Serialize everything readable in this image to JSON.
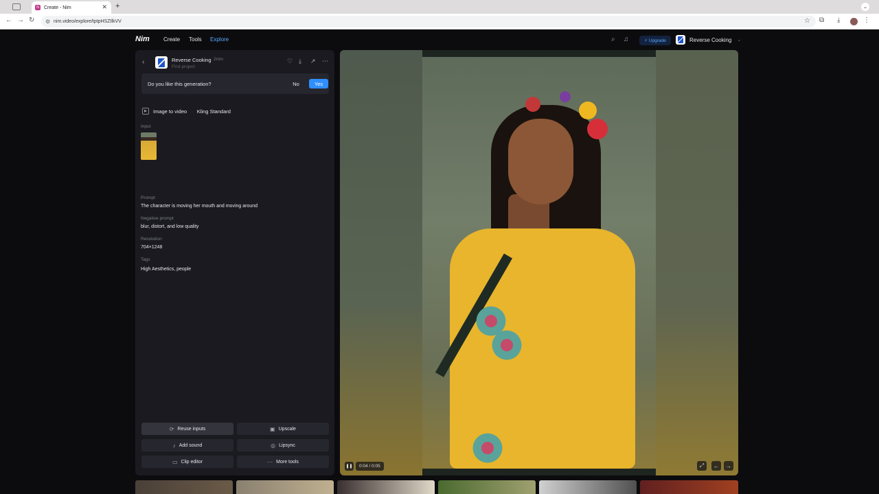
{
  "browser": {
    "tab_title": "Create - Nim",
    "tab_favicon": "N",
    "url": "nim.video/explore/tptpHSZIlkVV"
  },
  "nav": {
    "logo": "Nim",
    "links": [
      "Create",
      "Tools",
      "Explore"
    ],
    "active": "Explore",
    "upgrade_label": "Upgrade",
    "account_name": "Reverse Cooking"
  },
  "generation": {
    "project_title": "Reverse Cooking",
    "time_ago": "2min",
    "project_subtitle": "First project",
    "feedback_question": "Do you like this generation?",
    "feedback_no": "No",
    "feedback_yes": "Yes",
    "mode": "Image to video",
    "model": "Kling Standard",
    "input_label": "Input",
    "prompt_label": "Prompt",
    "prompt": "The character is moving her mouth and moving around",
    "negative_prompt_label": "Negative prompt",
    "negative_prompt": "blur, distort, and low quality",
    "resolution_label": "Resolution",
    "resolution": "704×1248",
    "tags_label": "Tags",
    "tags": "High Aesthetics, people"
  },
  "actions": {
    "reuse_inputs": "Reuse inputs",
    "upscale": "Upscale",
    "add_sound": "Add sound",
    "lipsync": "Lipsync",
    "clip_editor": "Clip editor",
    "more_tools": "More tools"
  },
  "player": {
    "time": "0:04 / 0:05"
  },
  "colors": {
    "accent": "#2f8fff",
    "active_nav": "#5aa9ff",
    "panel_bg": "#1a1a20"
  }
}
